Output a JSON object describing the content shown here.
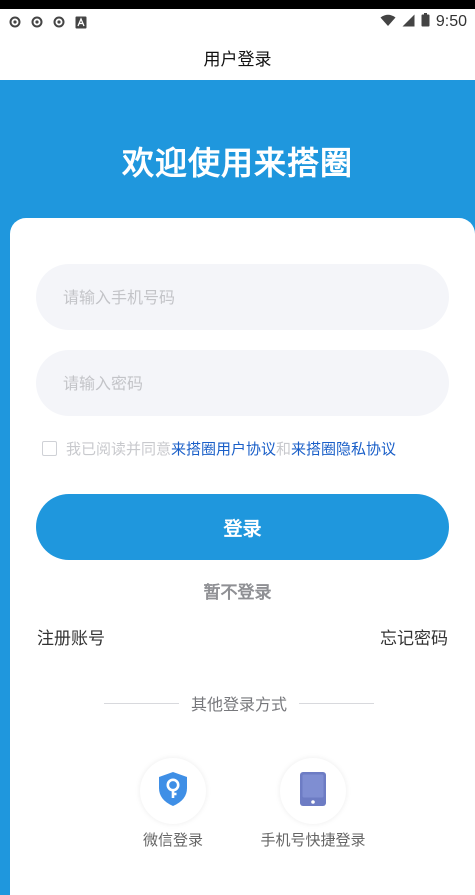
{
  "status": {
    "time": "9:50",
    "left_icons": [
      "notification-icon",
      "notification-icon",
      "notification-icon",
      "a-icon"
    ],
    "right_icons": [
      "wifi-icon",
      "signal-icon",
      "battery-icon"
    ]
  },
  "header": {
    "title": "用户登录"
  },
  "hero": {
    "welcome": "欢迎使用来搭圈"
  },
  "form": {
    "phone_placeholder": "请输入手机号码",
    "password_placeholder": "请输入密码",
    "agree_prefix": "我已阅读并同意",
    "agree_link1": "来搭圈用户协议",
    "agree_and": "和",
    "agree_link2": "来搭圈隐私协议",
    "login_label": "登录",
    "skip_label": "暂不登录",
    "register_label": "注册账号",
    "forgot_label": "忘记密码"
  },
  "other": {
    "title": "其他登录方式",
    "options": [
      {
        "label": "微信登录",
        "icon": "shield-key-icon"
      },
      {
        "label": "手机号快捷登录",
        "icon": "phone-icon"
      }
    ]
  },
  "colors": {
    "primary": "#1f97dd",
    "link": "#1a5fc8",
    "field_bg": "#f4f5f9",
    "placeholder": "#c3c4c8"
  }
}
